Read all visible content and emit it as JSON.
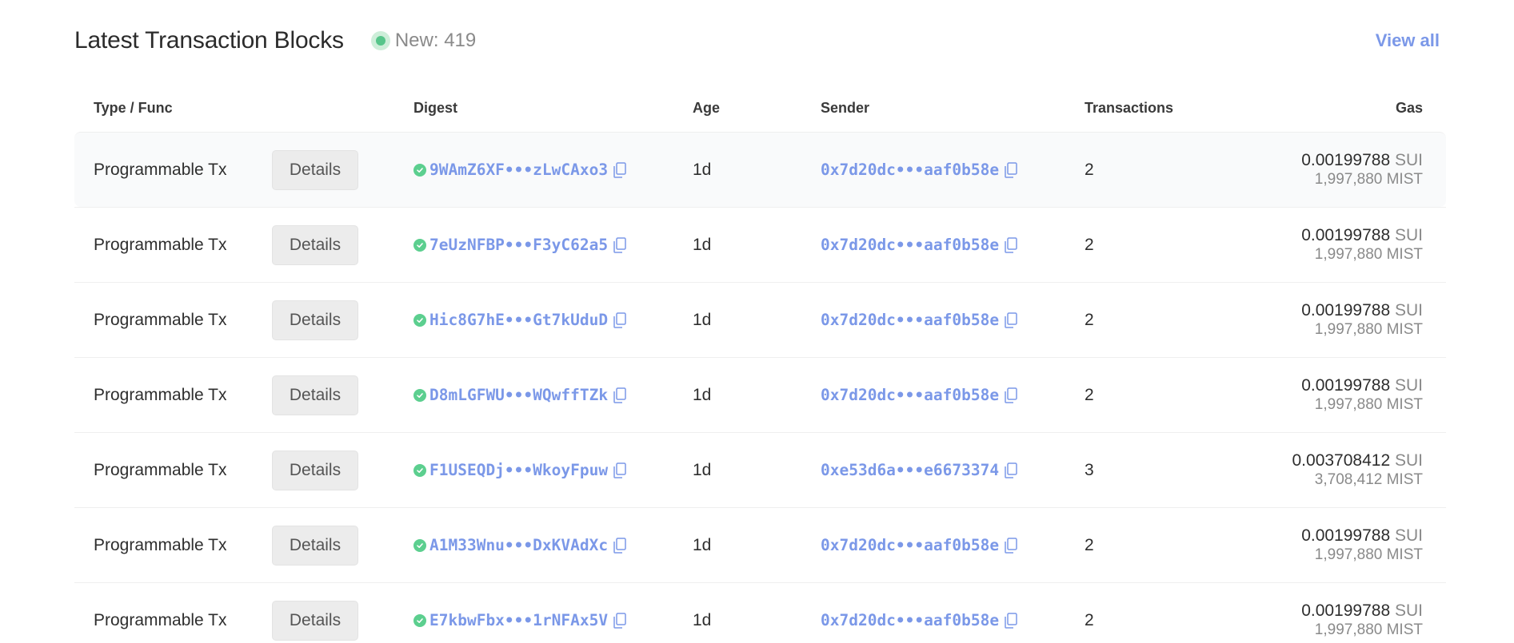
{
  "header": {
    "title": "Latest Transaction Blocks",
    "new_label": "New: 419",
    "view_all": "View all",
    "accent_color": "#7b98e8",
    "live_color": "#56c58a"
  },
  "table": {
    "columns": [
      "Type / Func",
      "Digest",
      "Age",
      "Sender",
      "Transactions",
      "Gas"
    ],
    "details_label": "Details",
    "gas_unit": "SUI",
    "rows": [
      {
        "type": "Programmable Tx",
        "digest": "9WAmZ6XF•••zLwCAxo3",
        "age": "1d",
        "sender": "0x7d20dc•••aaf0b58e",
        "transactions": "2",
        "gas_sui": "0.00199788",
        "gas_mist": "1,997,880 MIST"
      },
      {
        "type": "Programmable Tx",
        "digest": "7eUzNFBP•••F3yC62a5",
        "age": "1d",
        "sender": "0x7d20dc•••aaf0b58e",
        "transactions": "2",
        "gas_sui": "0.00199788",
        "gas_mist": "1,997,880 MIST"
      },
      {
        "type": "Programmable Tx",
        "digest": "Hic8G7hE•••Gt7kUduD",
        "age": "1d",
        "sender": "0x7d20dc•••aaf0b58e",
        "transactions": "2",
        "gas_sui": "0.00199788",
        "gas_mist": "1,997,880 MIST"
      },
      {
        "type": "Programmable Tx",
        "digest": "D8mLGFWU•••WQwffTZk",
        "age": "1d",
        "sender": "0x7d20dc•••aaf0b58e",
        "transactions": "2",
        "gas_sui": "0.00199788",
        "gas_mist": "1,997,880 MIST"
      },
      {
        "type": "Programmable Tx",
        "digest": "F1USEQDj•••WkoyFpuw",
        "age": "1d",
        "sender": "0xe53d6a•••e6673374",
        "transactions": "3",
        "gas_sui": "0.003708412",
        "gas_mist": "3,708,412 MIST"
      },
      {
        "type": "Programmable Tx",
        "digest": "A1M33Wnu•••DxKVAdXc",
        "age": "1d",
        "sender": "0x7d20dc•••aaf0b58e",
        "transactions": "2",
        "gas_sui": "0.00199788",
        "gas_mist": "1,997,880 MIST"
      },
      {
        "type": "Programmable Tx",
        "digest": "E7kbwFbx•••1rNFAx5V",
        "age": "1d",
        "sender": "0x7d20dc•••aaf0b58e",
        "transactions": "2",
        "gas_sui": "0.00199788",
        "gas_mist": "1,997,880 MIST"
      }
    ]
  },
  "icons": {
    "status": "check-circle-icon",
    "copy": "copy-icon"
  }
}
